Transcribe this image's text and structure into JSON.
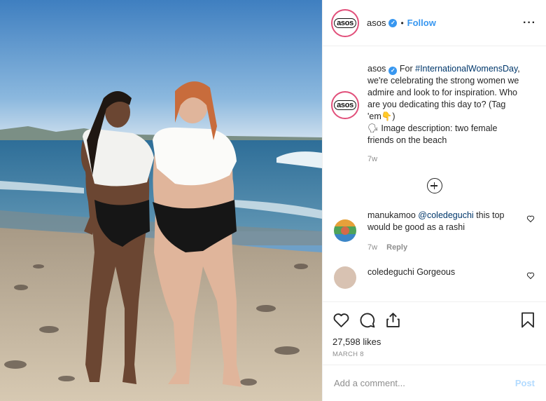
{
  "photo": {
    "icon": "beach-photo"
  },
  "header": {
    "avatar_text": "asos",
    "username": "asos",
    "separator": "•",
    "follow_label": "Follow",
    "more_label": "···"
  },
  "caption": {
    "avatar_text": "asos",
    "username": "asos",
    "prefix": "For",
    "hashtag": "#InternationalWomensDay",
    "body": ", we're celebrating the strong women we admire and look to for inspiration. Who are you dedicating this day to? (Tag 'em👇)",
    "description": "🗣 Image description: two female friends on the beach",
    "time": "7w"
  },
  "comments": [
    {
      "username": "manukamoo",
      "mention": "@coledeguchi",
      "text": " this top would be good as a rashi",
      "time": "7w",
      "reply_label": "Reply"
    },
    {
      "username": "coledeguchi",
      "text": "Gorgeous"
    }
  ],
  "actions": {
    "likes": "27,598 likes",
    "date": "MARCH 8"
  },
  "composer": {
    "placeholder": "Add a comment...",
    "post_label": "Post"
  },
  "colors": {
    "accent": "#3897f0",
    "ring": "#e14f7a",
    "post_disabled": "#b3dbff"
  }
}
